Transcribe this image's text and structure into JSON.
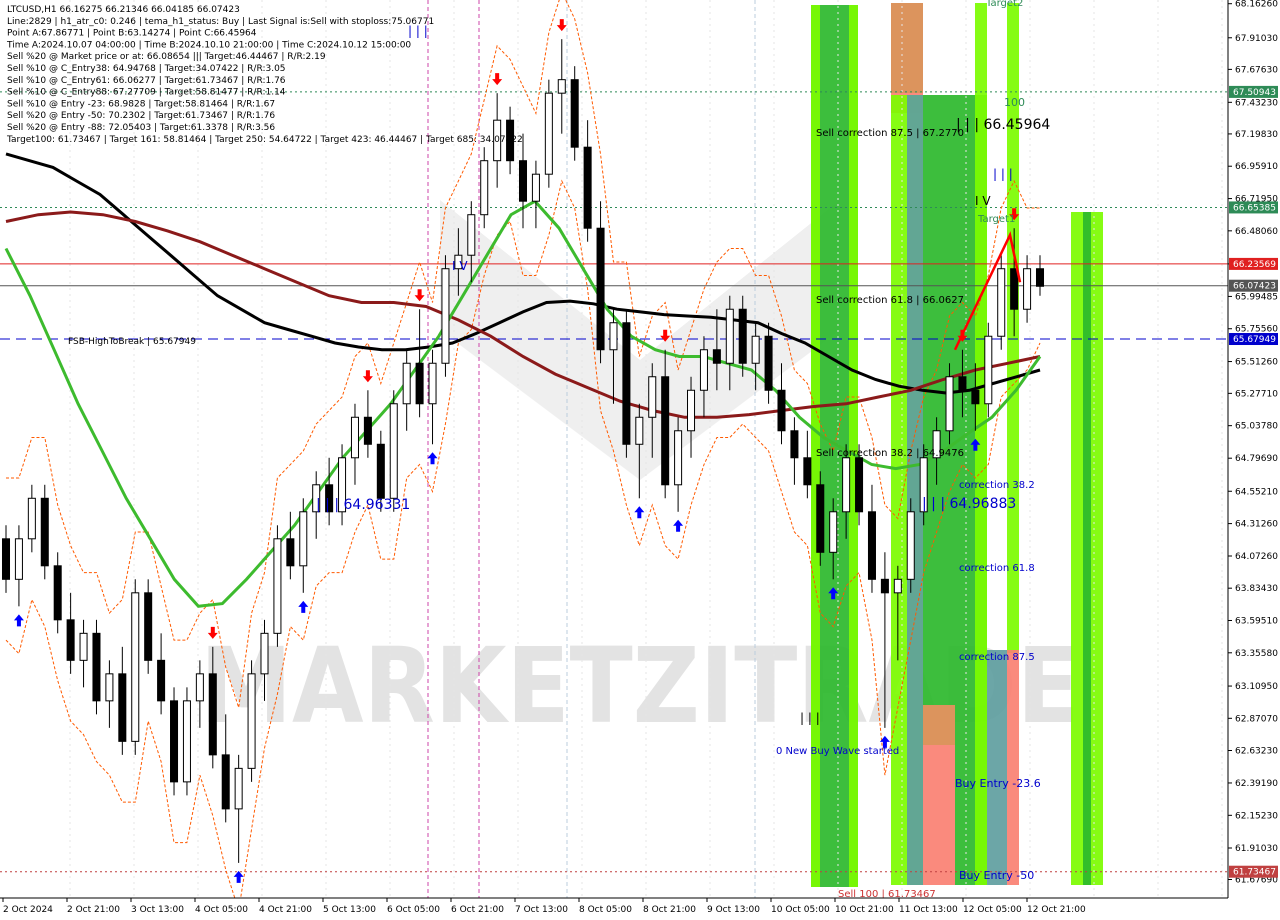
{
  "info_panel": {
    "lines": [
      "LTCUSD,H1   66.16275 66.21346 66.04185 66.07423",
      "Line:2829  |  h1_atr_c0: 0.246  |  tema_h1_status: Buy  |  Last Signal is:Sell with stoploss:75.06771",
      "Point A:67.86771  |  Point B:63.14274  |  Point C:66.45964",
      "Time A:2024.10.07 04:00:00  |  Time B:2024.10.10 21:00:00  |  Time C:2024.10.12 15:00:00",
      "Sell %20 @ Market price or at: 66.08654  |||  Target:46.44467  |  R/R:2.19",
      "Sell %10 @ C_Entry38: 64.94768  |  Target:34.07422  |  R/R:3.05",
      "Sell %10 @ C_Entry61: 66.06277  |  Target:61.73467  |  R/R:1.76",
      "Sell %10 @ C_Entry88: 67.27709  |  Target:58.81477  |  R/R:1.14",
      "Sell %10 @ Entry -23: 68.9828  |  Target:58.81464  |  R/R:1.67",
      "Sell %20 @ Entry -50: 70.2302  |  Target:61.73467  |  R/R:1.76",
      "Sell %20 @ Entry -88: 72.05403  |  Target:61.3378  |  R/R:3.56",
      "Target100: 61.73467  |  Target 161: 58.81464  |  Target 250: 54.64722  |  Target 423: 46.44467  |  Target 685: 34.07422"
    ]
  },
  "watermark": "MARKETZITRADE",
  "chart_data": {
    "type": "candlestick",
    "symbol": "LTCUSD",
    "timeframe": "H1",
    "ylim": [
      61.54,
      68.19
    ],
    "y_ticks": [
      "68.16260",
      "67.91030",
      "67.67630",
      "67.43230",
      "67.19830",
      "66.95910",
      "66.71950",
      "66.48060",
      "66.23569",
      "65.99485",
      "65.75560",
      "65.51260",
      "65.27710",
      "65.03780",
      "64.79690",
      "64.55210",
      "64.31260",
      "64.07260",
      "63.83430",
      "63.59510",
      "63.35580",
      "63.10950",
      "62.87070",
      "62.63230",
      "62.39190",
      "62.15230",
      "61.91030",
      "61.67690"
    ],
    "x_ticks": [
      "2 Oct 2024",
      "2 Oct 21:00",
      "3 Oct 13:00",
      "4 Oct 05:00",
      "4 Oct 21:00",
      "5 Oct 13:00",
      "6 Oct 05:00",
      "6 Oct 21:00",
      "7 Oct 13:00",
      "8 Oct 05:00",
      "8 Oct 21:00",
      "9 Oct 13:00",
      "10 Oct 05:00",
      "10 Oct 21:00",
      "11 Oct 13:00",
      "12 Oct 05:00",
      "12 Oct 21:00"
    ],
    "candles": [
      [
        64.2,
        64.3,
        63.8,
        63.9
      ],
      [
        63.9,
        64.3,
        63.7,
        64.2
      ],
      [
        64.2,
        64.6,
        64.1,
        64.5
      ],
      [
        64.5,
        64.6,
        63.9,
        64.0
      ],
      [
        64.0,
        64.1,
        63.5,
        63.6
      ],
      [
        63.6,
        63.8,
        63.2,
        63.3
      ],
      [
        63.3,
        63.6,
        63.1,
        63.5
      ],
      [
        63.5,
        63.6,
        62.9,
        63.0
      ],
      [
        63.0,
        63.3,
        62.8,
        63.2
      ],
      [
        63.2,
        63.4,
        62.6,
        62.7
      ],
      [
        62.7,
        63.9,
        62.6,
        63.8
      ],
      [
        63.8,
        63.9,
        63.2,
        63.3
      ],
      [
        63.3,
        63.5,
        62.9,
        63.0
      ],
      [
        63.0,
        63.1,
        62.3,
        62.4
      ],
      [
        62.4,
        63.1,
        62.3,
        63.0
      ],
      [
        63.0,
        63.3,
        62.8,
        63.2
      ],
      [
        63.2,
        63.4,
        62.5,
        62.6
      ],
      [
        62.6,
        62.9,
        62.1,
        62.2
      ],
      [
        62.2,
        62.6,
        61.8,
        62.5
      ],
      [
        62.5,
        63.3,
        62.4,
        63.2
      ],
      [
        63.2,
        63.6,
        63.0,
        63.5
      ],
      [
        63.5,
        64.3,
        63.4,
        64.2
      ],
      [
        64.2,
        64.4,
        63.9,
        64.0
      ],
      [
        64.0,
        64.5,
        63.8,
        64.4
      ],
      [
        64.4,
        64.7,
        64.2,
        64.6
      ],
      [
        64.6,
        64.8,
        64.3,
        64.4
      ],
      [
        64.4,
        64.9,
        64.3,
        64.8
      ],
      [
        64.8,
        65.2,
        64.6,
        65.1
      ],
      [
        65.1,
        65.3,
        64.8,
        64.9
      ],
      [
        64.9,
        65.0,
        64.4,
        64.5
      ],
      [
        64.5,
        65.3,
        64.4,
        65.2
      ],
      [
        65.2,
        65.6,
        65.0,
        65.5
      ],
      [
        65.5,
        65.9,
        65.1,
        65.2
      ],
      [
        65.2,
        65.6,
        64.9,
        65.5
      ],
      [
        65.5,
        66.3,
        65.4,
        66.2
      ],
      [
        66.2,
        66.5,
        66.0,
        66.3
      ],
      [
        66.3,
        66.7,
        66.1,
        66.6
      ],
      [
        66.6,
        67.1,
        66.5,
        67.0
      ],
      [
        67.0,
        67.5,
        66.8,
        67.3
      ],
      [
        67.3,
        67.4,
        66.9,
        67.0
      ],
      [
        67.0,
        67.2,
        66.5,
        66.7
      ],
      [
        66.7,
        67.0,
        66.5,
        66.9
      ],
      [
        66.9,
        67.6,
        66.8,
        67.5
      ],
      [
        67.5,
        67.9,
        67.2,
        67.6
      ],
      [
        67.6,
        67.7,
        67.0,
        67.1
      ],
      [
        67.1,
        67.3,
        66.4,
        66.5
      ],
      [
        66.5,
        66.7,
        65.5,
        65.6
      ],
      [
        65.6,
        65.9,
        65.2,
        65.8
      ],
      [
        65.8,
        65.9,
        64.8,
        64.9
      ],
      [
        64.9,
        65.2,
        64.5,
        65.1
      ],
      [
        65.1,
        65.5,
        64.8,
        65.4
      ],
      [
        65.4,
        65.6,
        64.5,
        64.6
      ],
      [
        64.6,
        65.1,
        64.4,
        65.0
      ],
      [
        65.0,
        65.4,
        64.8,
        65.3
      ],
      [
        65.3,
        65.7,
        65.1,
        65.6
      ],
      [
        65.6,
        65.9,
        65.3,
        65.5
      ],
      [
        65.5,
        66.0,
        65.3,
        65.9
      ],
      [
        65.9,
        66.0,
        65.4,
        65.5
      ],
      [
        65.5,
        65.8,
        65.3,
        65.7
      ],
      [
        65.7,
        65.8,
        65.2,
        65.3
      ],
      [
        65.3,
        65.5,
        64.9,
        65.0
      ],
      [
        65.0,
        65.1,
        64.6,
        64.8
      ],
      [
        64.8,
        65.0,
        64.5,
        64.6
      ],
      [
        64.6,
        64.7,
        64.0,
        64.1
      ],
      [
        64.1,
        64.5,
        63.9,
        64.4
      ],
      [
        64.4,
        64.9,
        64.2,
        64.8
      ],
      [
        64.8,
        64.9,
        64.3,
        64.4
      ],
      [
        64.4,
        64.6,
        63.8,
        63.9
      ],
      [
        63.9,
        64.1,
        62.8,
        63.8
      ],
      [
        63.8,
        64.0,
        63.3,
        63.9
      ],
      [
        63.9,
        64.5,
        63.8,
        64.4
      ],
      [
        64.4,
        64.9,
        64.3,
        64.8
      ],
      [
        64.8,
        65.1,
        64.6,
        65.0
      ],
      [
        65.0,
        65.5,
        64.9,
        65.4
      ],
      [
        65.4,
        65.6,
        65.1,
        65.3
      ],
      [
        65.3,
        65.5,
        65.0,
        65.2
      ],
      [
        65.2,
        65.8,
        65.1,
        65.7
      ],
      [
        65.7,
        66.3,
        65.6,
        66.2
      ],
      [
        66.2,
        66.5,
        65.7,
        65.9
      ],
      [
        65.9,
        66.3,
        65.8,
        66.2
      ],
      [
        66.2,
        66.3,
        66.0,
        66.07
      ]
    ],
    "moving_averages": [
      {
        "color": "#000000",
        "values": [
          67.05,
          67.0,
          66.95,
          66.85,
          66.75,
          66.6,
          66.45,
          66.3,
          66.15,
          66.0,
          65.9,
          65.8,
          65.75,
          65.7,
          65.65,
          65.62,
          65.6,
          65.6,
          65.62,
          65.65,
          65.72,
          65.8,
          65.88,
          65.95,
          65.96,
          65.94,
          65.9,
          65.88,
          65.86,
          65.85,
          65.84,
          65.82,
          65.8,
          65.72,
          65.65,
          65.55,
          65.45,
          65.38,
          65.33,
          65.3,
          65.28,
          65.3,
          65.35,
          65.4,
          65.45
        ]
      },
      {
        "color": "#8b1a1a",
        "values": [
          66.55,
          66.6,
          66.62,
          66.6,
          66.55,
          66.48,
          66.4,
          66.3,
          66.2,
          66.1,
          66.0,
          65.95,
          65.95,
          65.92,
          65.82,
          65.7,
          65.55,
          65.42,
          65.32,
          65.22,
          65.15,
          65.1,
          65.1,
          65.12,
          65.15,
          65.18,
          65.2,
          65.25,
          65.3,
          65.38,
          65.45,
          65.5,
          65.55
        ]
      },
      {
        "color": "#3dbb2e",
        "values": [
          66.35,
          66.0,
          65.6,
          65.2,
          64.85,
          64.5,
          64.2,
          63.9,
          63.7,
          63.72,
          63.9,
          64.1,
          64.3,
          64.55,
          64.8,
          65.0,
          65.2,
          65.45,
          65.7,
          66.0,
          66.3,
          66.6,
          66.7,
          66.5,
          66.2,
          65.9,
          65.7,
          65.6,
          65.55,
          65.55,
          65.5,
          65.45,
          65.3,
          65.1,
          64.95,
          64.85,
          64.75,
          64.72,
          64.75,
          64.85,
          64.98,
          65.1,
          65.3,
          65.55
        ]
      }
    ],
    "horizontal_levels": [
      {
        "value": 67.50943,
        "label": "67.50943",
        "color": "#2e8b57",
        "style": "dotted"
      },
      {
        "value": 66.65385,
        "label": "66.65385",
        "color": "#2e8b57",
        "style": "dotted"
      },
      {
        "value": 66.23569,
        "label": "66.23569",
        "color": "#e02020",
        "style": "solid"
      },
      {
        "value": 66.07423,
        "label": "66.07423",
        "color": "#555555",
        "style": "solid"
      },
      {
        "value": 65.67949,
        "label": "65.67949",
        "color": "#0000cc",
        "style": "dashed"
      },
      {
        "value": 61.73467,
        "label": "61.73467",
        "color": "#c04040",
        "style": "dotted"
      }
    ],
    "annotations": [
      {
        "text": "FSB-HighToBreak  |  65.67949",
        "color": "#000000",
        "size": 9
      },
      {
        "text": "| | | 64.96331",
        "color": "#0000cc",
        "size": 14
      },
      {
        "text": "| | |",
        "color": "#0000cc",
        "size": 12
      },
      {
        "text": "I V",
        "color": "#0000cc",
        "size": 12
      },
      {
        "text": "Sell correction 87.5 | 67.2770",
        "color": "#000000",
        "size": 10
      },
      {
        "text": "| | | 66.45964",
        "color": "#000000",
        "size": 14
      },
      {
        "text": "100",
        "color": "#2e8b57",
        "size": 11
      },
      {
        "text": "Target2",
        "color": "#2e8b57",
        "size": 10
      },
      {
        "text": "Target1",
        "color": "#2e8b57",
        "size": 10
      },
      {
        "text": "I V",
        "color": "#000000",
        "size": 12
      },
      {
        "text": "| | |",
        "color": "#0000cc",
        "size": 12
      },
      {
        "text": "Sell correction 61.8 | 66.0627",
        "color": "#000000",
        "size": 10
      },
      {
        "text": "Sell correction 38.2 | 64.9476",
        "color": "#000000",
        "size": 10
      },
      {
        "text": "| | | 64.96883",
        "color": "#0000cc",
        "size": 14
      },
      {
        "text": "correction 38.2",
        "color": "#0000cc",
        "size": 10
      },
      {
        "text": "correction 61.8",
        "color": "#0000cc",
        "size": 10
      },
      {
        "text": "correction 87.5",
        "color": "#0000cc",
        "size": 10
      },
      {
        "text": "0 New Buy Wave started",
        "color": "#0000cc",
        "size": 10
      },
      {
        "text": "Buy Entry -23.6",
        "color": "#0000cc",
        "size": 11
      },
      {
        "text": "Buy Entry -50",
        "color": "#0000cc",
        "size": 11
      },
      {
        "text": "Sell 100 | 61.73467",
        "color": "#cc3333",
        "size": 10
      },
      {
        "text": "| | |",
        "color": "#000000",
        "size": 12
      }
    ],
    "colors": {
      "bar_green": "#2db92d",
      "bar_lime": "#7cfc00",
      "bar_red": "#fa8072",
      "bar_orange": "#d9955a",
      "bar_teal": "#5f9ea0",
      "arrow_up": "#0000ff",
      "arrow_down": "#ff0000",
      "channel": "#ff5a00"
    }
  }
}
